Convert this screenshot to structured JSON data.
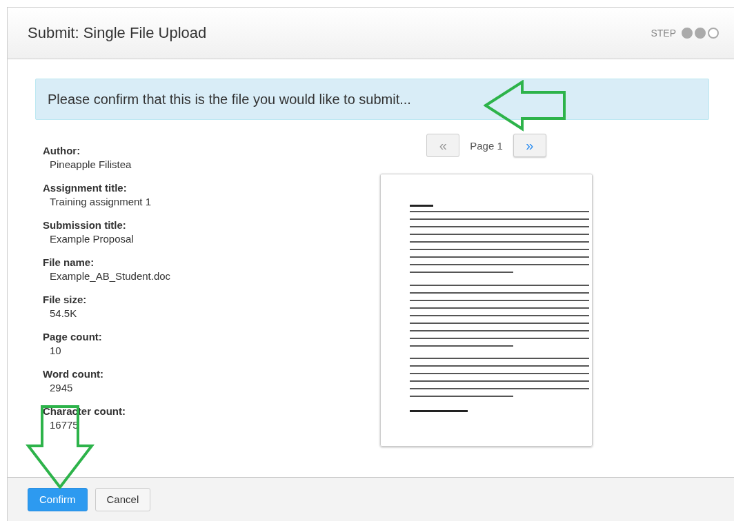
{
  "dialog": {
    "title": "Submit: Single File Upload",
    "step_label": "STEP",
    "steps": [
      {
        "done": true
      },
      {
        "done": true
      },
      {
        "done": false
      }
    ]
  },
  "banner": "Please confirm that this is the file you would like to submit...",
  "details": [
    {
      "label": "Author:",
      "value": "Pineapple Filistea"
    },
    {
      "label": "Assignment title:",
      "value": "Training assignment 1"
    },
    {
      "label": "Submission title:",
      "value": "Example Proposal"
    },
    {
      "label": "File name:",
      "value": "Example_AB_Student.doc"
    },
    {
      "label": "File size:",
      "value": "54.5K"
    },
    {
      "label": "Page count:",
      "value": "10"
    },
    {
      "label": "Word count:",
      "value": "2945"
    },
    {
      "label": "Character count:",
      "value": "16775"
    }
  ],
  "pager": {
    "prev": {
      "label": "«",
      "disabled": true
    },
    "page": "Page 1",
    "next": {
      "label": "»",
      "disabled": false
    }
  },
  "buttons": [
    {
      "label": "Confirm",
      "kind": "primary"
    },
    {
      "label": "Cancel",
      "kind": "default"
    }
  ]
}
